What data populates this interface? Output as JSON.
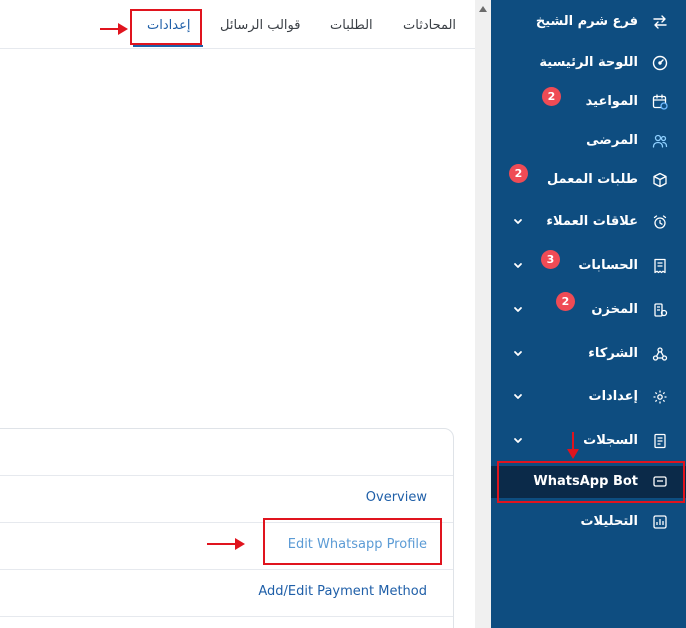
{
  "tabs": [
    {
      "label": "المحادثات"
    },
    {
      "label": "الطلبات"
    },
    {
      "label": "قوالب الرسائل"
    },
    {
      "label": "إعدادات"
    }
  ],
  "panel": {
    "links": [
      {
        "label": "Overview"
      },
      {
        "label": "Edit Whatsapp Profile"
      },
      {
        "label": "Add/Edit Payment Method"
      }
    ]
  },
  "sidebar": {
    "items": [
      {
        "label": "فرع شرم الشيخ",
        "icon": "swap-arrows-icon"
      },
      {
        "label": "اللوحة الرئيسية",
        "icon": "dashboard-gauge-icon"
      },
      {
        "label": "المواعيد",
        "icon": "calendar-clock-icon",
        "badge": "2"
      },
      {
        "label": "المرضى",
        "icon": "users-icon"
      },
      {
        "label": "طلبات المعمل",
        "icon": "box-icon",
        "badge": "2"
      },
      {
        "label": "علاقات العملاء",
        "icon": "alarm-clock-icon",
        "expandable": true
      },
      {
        "label": "الحسابات",
        "icon": "receipt-icon",
        "badge": "3",
        "expandable": true
      },
      {
        "label": "المخزن",
        "icon": "warehouse-icon",
        "badge": "2",
        "expandable": true
      },
      {
        "label": "الشركاء",
        "icon": "partners-network-icon",
        "expandable": true
      },
      {
        "label": "إعدادات",
        "icon": "gear-icon",
        "expandable": true
      },
      {
        "label": "السجلات",
        "icon": "logs-icon",
        "expandable": true
      },
      {
        "label": "WhatsApp Bot",
        "icon": "chat-bubble-icon",
        "active": true
      },
      {
        "label": "التحليلات",
        "icon": "analytics-icon"
      }
    ]
  },
  "colors": {
    "sidebar_bg": "#0e4d80",
    "sidebar_active_bg": "#0b2a49",
    "badge": "#ef4b55",
    "link": "#1f5fa8",
    "annotation": "#e0141e"
  }
}
